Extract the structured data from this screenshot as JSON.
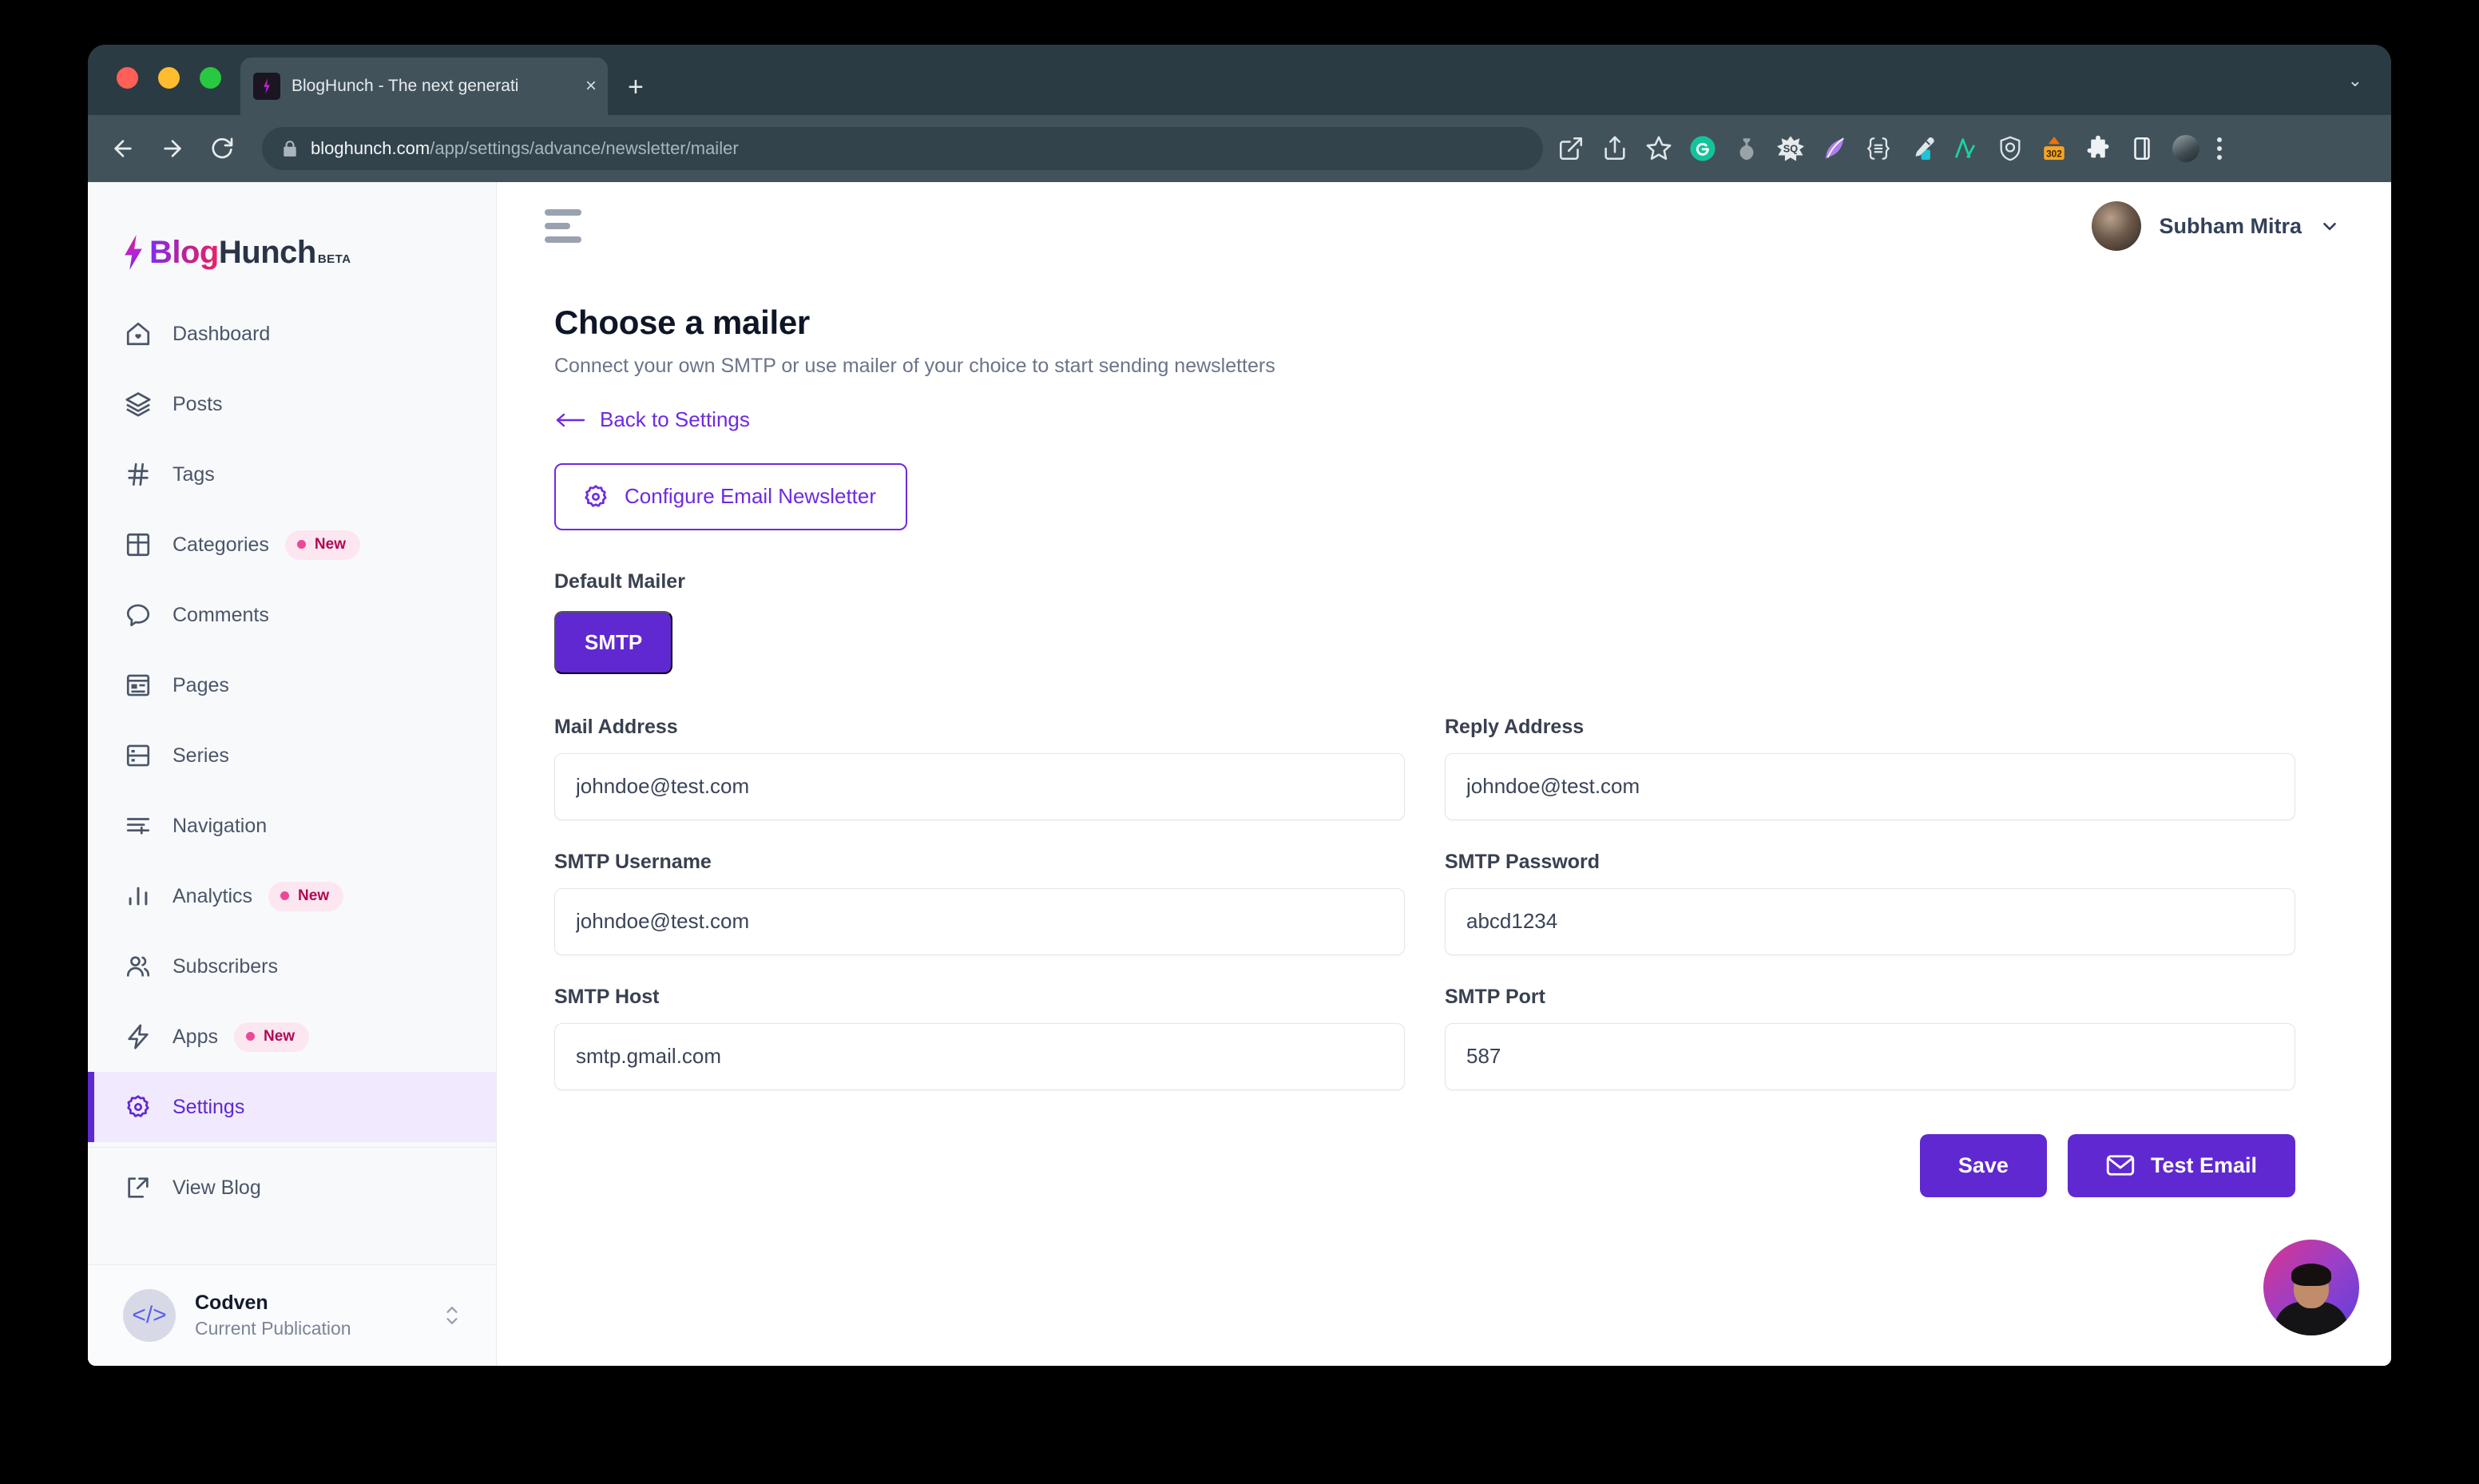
{
  "browser": {
    "tab": {
      "title": "BlogHunch - The next generati",
      "favicon": "bolt-icon",
      "close_label": "×"
    },
    "new_tab_label": "+",
    "tab_list_chevron": "⌄",
    "url": {
      "host": "bloghunch.com",
      "path": "/app/settings/advance/newsletter/mailer"
    },
    "extensions": [
      "open-in-new-icon",
      "share-icon",
      "bookmark-star-icon",
      "grammarly-icon",
      "honey-icon",
      "stacksocial-icon",
      "quill-icon",
      "json-formatter-icon",
      "eyedropper-icon",
      "algolia-icon",
      "shield-icon",
      "redirect-302-icon",
      "puzzle-extensions-icon",
      "sidepanel-icon",
      "profile-avatar",
      "kebab-menu-icon"
    ],
    "redirect_badge": "302"
  },
  "sidebar": {
    "brand": {
      "blog": "Blog",
      "hunch": "Hunch",
      "beta": "BETA"
    },
    "items": [
      {
        "label": "Dashboard",
        "icon": "home-icon",
        "badge": null,
        "active": false
      },
      {
        "label": "Posts",
        "icon": "layers-icon",
        "badge": null,
        "active": false
      },
      {
        "label": "Tags",
        "icon": "hash-icon",
        "badge": null,
        "active": false
      },
      {
        "label": "Categories",
        "icon": "grid-icon",
        "badge": "New",
        "active": false
      },
      {
        "label": "Comments",
        "icon": "comment-icon",
        "badge": null,
        "active": false
      },
      {
        "label": "Pages",
        "icon": "page-icon",
        "badge": null,
        "active": false
      },
      {
        "label": "Series",
        "icon": "series-icon",
        "badge": null,
        "active": false
      },
      {
        "label": "Navigation",
        "icon": "navigation-icon",
        "badge": null,
        "active": false
      },
      {
        "label": "Analytics",
        "icon": "bar-chart-icon",
        "badge": "New",
        "active": false
      },
      {
        "label": "Subscribers",
        "icon": "users-icon",
        "badge": null,
        "active": false
      },
      {
        "label": "Apps",
        "icon": "lightning-icon",
        "badge": "New",
        "active": false
      },
      {
        "label": "Settings",
        "icon": "gear-icon",
        "badge": null,
        "active": true
      }
    ],
    "view_blog": {
      "label": "View Blog",
      "icon": "external-link-icon"
    },
    "publication": {
      "name": "Codven",
      "subtitle": "Current Publication",
      "avatar_glyph": "</>"
    }
  },
  "header": {
    "menu_icon": "hamburger-icon",
    "user": {
      "name": "Subham Mitra",
      "chevron": "chevron-down-icon"
    }
  },
  "main": {
    "title": "Choose a mailer",
    "subtitle": "Connect your own SMTP or use mailer of your choice to start sending newsletters",
    "back_link": "Back to Settings",
    "configure_button": "Configure Email Newsletter",
    "default_mailer_label": "Default Mailer",
    "mailer_chip": "SMTP",
    "fields": [
      {
        "label": "Mail Address",
        "value": "johndoe@test.com",
        "placeholder": "Mail Address",
        "name": "mail-address"
      },
      {
        "label": "Reply Address",
        "value": "johndoe@test.com",
        "placeholder": "Reply Address",
        "name": "reply-address"
      },
      {
        "label": "SMTP Username",
        "value": "johndoe@test.com",
        "placeholder": "SMTP Username",
        "name": "smtp-username"
      },
      {
        "label": "SMTP Password",
        "value": "abcd1234",
        "placeholder": "SMTP Password",
        "name": "smtp-password"
      },
      {
        "label": "SMTP Host",
        "value": "smtp.gmail.com",
        "placeholder": "SMTP Host",
        "name": "smtp-host"
      },
      {
        "label": "SMTP Port",
        "value": "587",
        "placeholder": "SMTP Port",
        "name": "smtp-port"
      }
    ],
    "save_button": "Save",
    "test_email_button": "Test Email"
  },
  "chat_widget": {
    "name": "support-chat-avatar"
  },
  "colors": {
    "accent_purple": "#6028d0",
    "link_purple": "#6f2ae0",
    "active_nav_bg": "#f1e9fe",
    "badge_bg": "#fce7f1",
    "badge_text": "#b00a52",
    "sidebar_bg": "#f8f9fb",
    "browser_chrome": "#2b3b43",
    "toolbar": "#41525b"
  }
}
